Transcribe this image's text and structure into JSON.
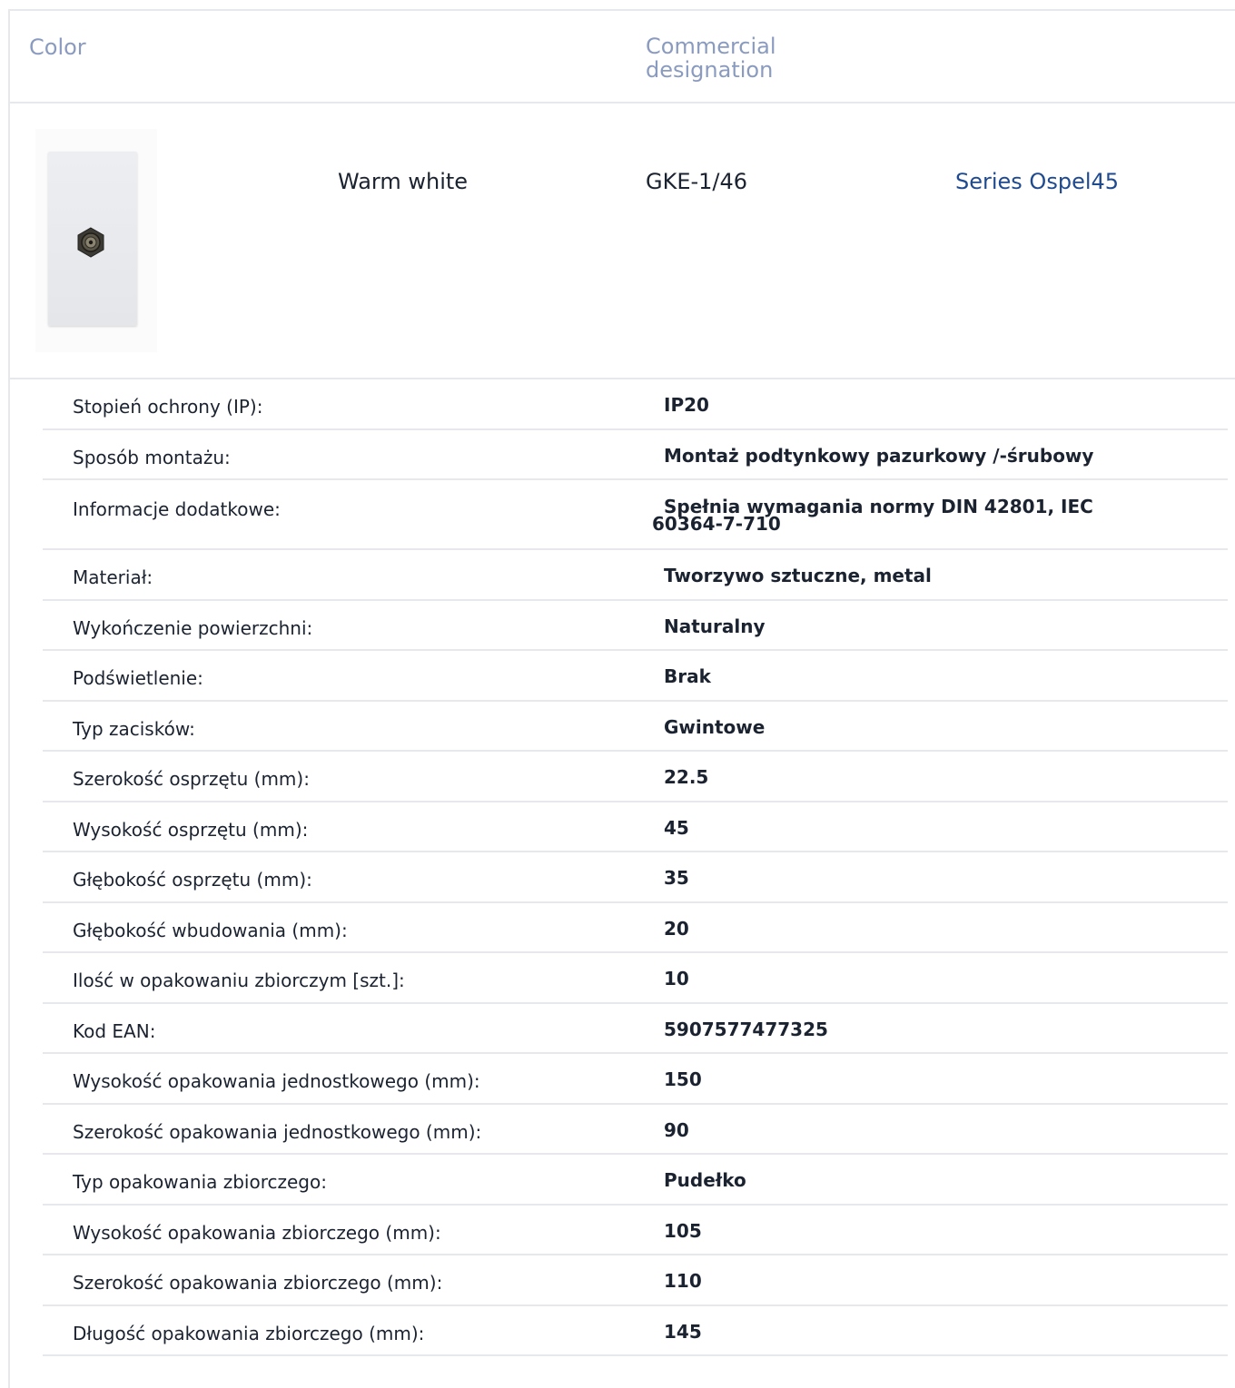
{
  "header": {
    "color_label": "Color",
    "designation_label": "Commercial designation"
  },
  "product": {
    "image_alt": "product-thumbnail",
    "color": "Warm white",
    "designation": "GKE-1/46",
    "series": "Series Ospel45"
  },
  "specs": [
    {
      "label": "Stopień ochrony (IP):",
      "value": "IP20"
    },
    {
      "label": "Sposób montażu:",
      "value": "Montaż podtynkowy pazurkowy /-śrubowy"
    },
    {
      "label": "Informacje dodatkowe:",
      "value": "Spełnia wymagania normy DIN 42801, IEC 60364-7-710"
    },
    {
      "label": "Materiał:",
      "value": "Tworzywo sztuczne, metal"
    },
    {
      "label": "Wykończenie powierzchni:",
      "value": "Naturalny"
    },
    {
      "label": "Podświetlenie:",
      "value": "Brak"
    },
    {
      "label": "Typ zacisków:",
      "value": "Gwintowe"
    },
    {
      "label": "Szerokość osprzętu (mm):",
      "value": "22.5"
    },
    {
      "label": "Wysokość osprzętu (mm):",
      "value": "45"
    },
    {
      "label": "Głębokość osprzętu (mm):",
      "value": "35"
    },
    {
      "label": "Głębokość wbudowania (mm):",
      "value": "20"
    },
    {
      "label": "Ilość w opakowaniu zbiorczym [szt.]:",
      "value": "10"
    },
    {
      "label": "Kod EAN:",
      "value": "5907577477325"
    },
    {
      "label": "Wysokość opakowania jednostkowego (mm):",
      "value": "150"
    },
    {
      "label": "Szerokość opakowania jednostkowego (mm):",
      "value": "90"
    },
    {
      "label": "Typ opakowania zbiorczego:",
      "value": "Pudełko"
    },
    {
      "label": "Wysokość opakowania zbiorczego (mm):",
      "value": "105"
    },
    {
      "label": "Szerokość opakowania zbiorczego (mm):",
      "value": "110"
    },
    {
      "label": "Długość opakowania zbiorczego (mm):",
      "value": "145"
    }
  ]
}
